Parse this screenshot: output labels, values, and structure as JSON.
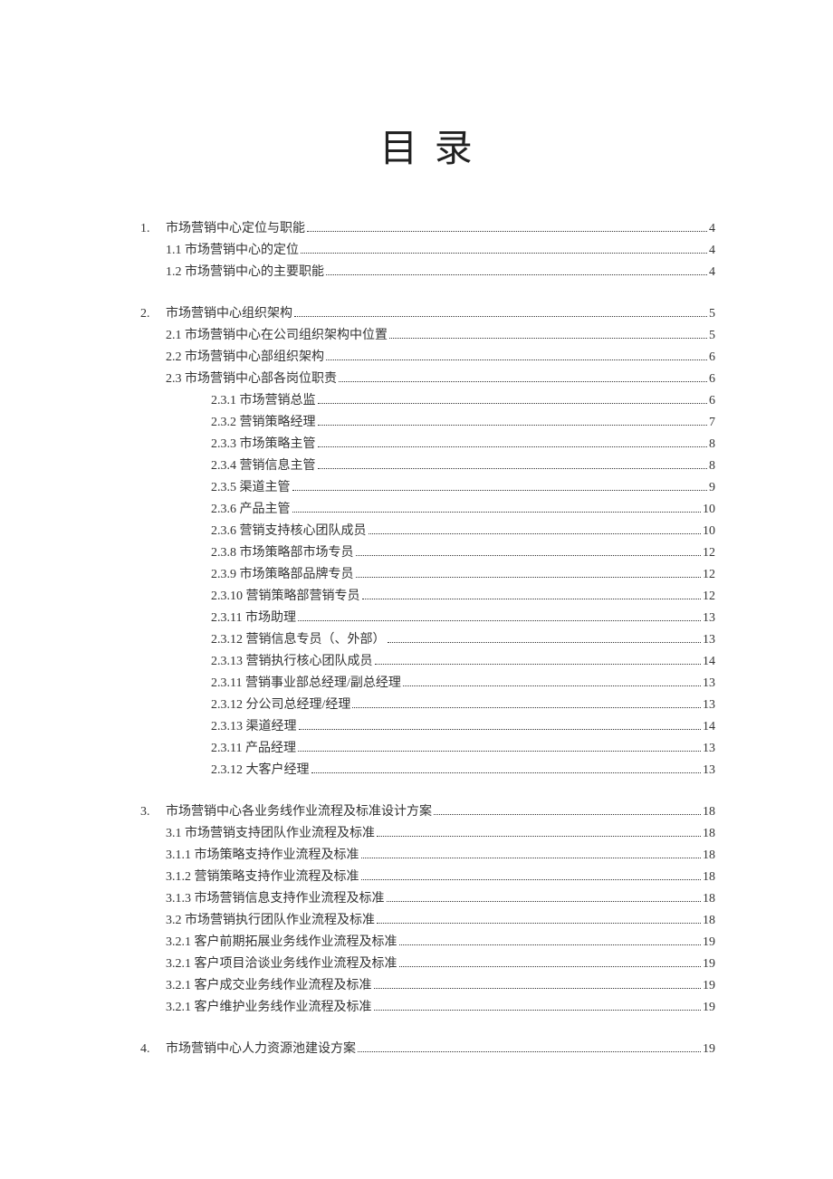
{
  "title": "目 录",
  "sections": [
    {
      "num": "1.",
      "entries": [
        {
          "indent": 0,
          "hasNum": true,
          "label": "市场营销中心定位与职能",
          "page": "4"
        },
        {
          "indent": 1,
          "hasNum": false,
          "label": "1.1 市场营销中心的定位",
          "page": "4"
        },
        {
          "indent": 1,
          "hasNum": false,
          "label": "1.2 市场营销中心的主要职能",
          "page": "4"
        }
      ]
    },
    {
      "num": "2.",
      "entries": [
        {
          "indent": 0,
          "hasNum": true,
          "label": "市场营销中心组织架构",
          "page": "5"
        },
        {
          "indent": 1,
          "hasNum": false,
          "label": "2.1 市场营销中心在公司组织架构中位置",
          "page": "5"
        },
        {
          "indent": 1,
          "hasNum": false,
          "label": "2.2 市场营销中心部组织架构",
          "page": "6"
        },
        {
          "indent": 1,
          "hasNum": false,
          "label": "2.3 市场营销中心部各岗位职责",
          "page": "6"
        },
        {
          "indent": 2,
          "hasNum": false,
          "label": "2.3.1 市场营销总监",
          "page": "6"
        },
        {
          "indent": 2,
          "hasNum": false,
          "label": "2.3.2 营销策略经理",
          "page": "7"
        },
        {
          "indent": 2,
          "hasNum": false,
          "label": "2.3.3 市场策略主管",
          "page": "8"
        },
        {
          "indent": 2,
          "hasNum": false,
          "label": "2.3.4 营销信息主管",
          "page": "8"
        },
        {
          "indent": 2,
          "hasNum": false,
          "label": "2.3.5 渠道主管",
          "page": "9"
        },
        {
          "indent": 2,
          "hasNum": false,
          "label": "2.3.6 产品主管",
          "page": "10"
        },
        {
          "indent": 2,
          "hasNum": false,
          "label": "2.3.6 营销支持核心团队成员",
          "page": "10"
        },
        {
          "indent": 2,
          "hasNum": false,
          "label": "2.3.8 市场策略部市场专员",
          "page": "12"
        },
        {
          "indent": 2,
          "hasNum": false,
          "label": "2.3.9 市场策略部品牌专员",
          "page": "12"
        },
        {
          "indent": 2,
          "hasNum": false,
          "label": "2.3.10 营销策略部营销专员",
          "page": "12"
        },
        {
          "indent": 2,
          "hasNum": false,
          "label": "2.3.11 市场助理",
          "page": "13"
        },
        {
          "indent": 2,
          "hasNum": false,
          "label": "2.3.12 营销信息专员（、外部）",
          "page": "13"
        },
        {
          "indent": 2,
          "hasNum": false,
          "label": "2.3.13 营销执行核心团队成员",
          "page": "14"
        },
        {
          "indent": 2,
          "hasNum": false,
          "label": "2.3.11 营销事业部总经理/副总经理",
          "page": "13"
        },
        {
          "indent": 2,
          "hasNum": false,
          "label": "2.3.12 分公司总经理/经理",
          "page": "13"
        },
        {
          "indent": 2,
          "hasNum": false,
          "label": "2.3.13 渠道经理",
          "page": "14"
        },
        {
          "indent": 2,
          "hasNum": false,
          "label": "2.3.11 产品经理",
          "page": "13"
        },
        {
          "indent": 2,
          "hasNum": false,
          "label": "2.3.12 大客户经理",
          "page": "13"
        }
      ]
    },
    {
      "num": "3.",
      "entries": [
        {
          "indent": 0,
          "hasNum": true,
          "label": "市场营销中心各业务线作业流程及标准设计方案",
          "page": "18"
        },
        {
          "indent": 1,
          "hasNum": false,
          "label": "3.1 市场营销支持团队作业流程及标准",
          "page": "18"
        },
        {
          "indent": 1,
          "hasNum": false,
          "label": "3.1.1 市场策略支持作业流程及标准",
          "page": "18"
        },
        {
          "indent": 1,
          "hasNum": false,
          "label": "3.1.2 营销策略支持作业流程及标准",
          "page": "18"
        },
        {
          "indent": 1,
          "hasNum": false,
          "label": "3.1.3 市场营销信息支持作业流程及标准",
          "page": "18"
        },
        {
          "indent": 1,
          "hasNum": false,
          "label": "3.2 市场营销执行团队作业流程及标准",
          "page": "18"
        },
        {
          "indent": 1,
          "hasNum": false,
          "label": "3.2.1 客户前期拓展业务线作业流程及标准",
          "page": "19"
        },
        {
          "indent": 1,
          "hasNum": false,
          "label": "3.2.1 客户项目洽谈业务线作业流程及标准",
          "page": "19"
        },
        {
          "indent": 1,
          "hasNum": false,
          "label": "3.2.1 客户成交业务线作业流程及标准",
          "page": "19"
        },
        {
          "indent": 1,
          "hasNum": false,
          "label": "3.2.1 客户维护业务线作业流程及标准",
          "page": "19"
        }
      ]
    },
    {
      "num": "4.",
      "entries": [
        {
          "indent": 0,
          "hasNum": true,
          "label": "市场营销中心人力资源池建设方案",
          "page": "19"
        }
      ]
    }
  ]
}
